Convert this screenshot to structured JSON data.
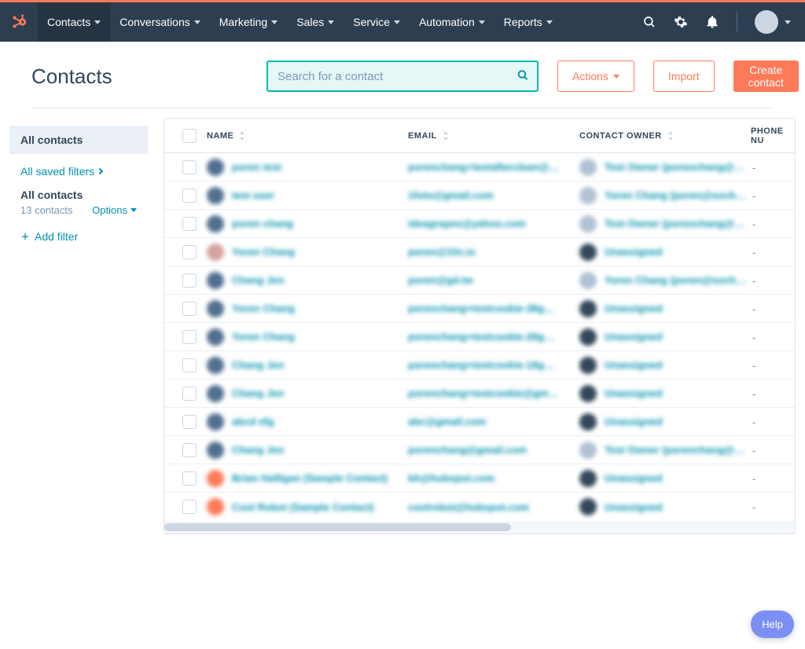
{
  "topnav": {
    "items": [
      {
        "label": "Contacts",
        "active": true
      },
      {
        "label": "Conversations"
      },
      {
        "label": "Marketing"
      },
      {
        "label": "Sales"
      },
      {
        "label": "Service"
      },
      {
        "label": "Automation"
      },
      {
        "label": "Reports"
      }
    ]
  },
  "header": {
    "title": "Contacts",
    "search_placeholder": "Search for a contact",
    "actions_label": "Actions",
    "import_label": "Import",
    "create_label": "Create contact"
  },
  "sidebar": {
    "all_label": "All contacts",
    "saved_filters_label": "All saved filters",
    "current_view": "All contacts",
    "count_text": "13 contacts",
    "options_label": "Options",
    "add_filter_label": "Add filter"
  },
  "table": {
    "columns": {
      "name": "NAME",
      "email": "EMAIL",
      "owner": "CONTACT OWNER",
      "phone": "PHONE NU"
    },
    "rows": [
      {
        "avatar": "default",
        "name": "poren test",
        "email": "porenchang+testafterclean@…",
        "owner": "Test Owner (porenchang@…",
        "owner_avatar": "light",
        "phone": "-"
      },
      {
        "avatar": "default",
        "name": "test user",
        "email": "1foto@gmail.com",
        "owner": "Yoren Chang (poren@soch…",
        "owner_avatar": "light",
        "phone": "-"
      },
      {
        "avatar": "default",
        "name": "poren chang",
        "email": "ideagrapes@yahoo.com",
        "owner": "Test Owner (porenchang@…",
        "owner_avatar": "light",
        "phone": "-"
      },
      {
        "avatar": "img",
        "name": "Yoren Chang",
        "email": "poren@10x.io",
        "owner": "Unassigned",
        "owner_avatar": "dark",
        "phone": "-"
      },
      {
        "avatar": "default",
        "name": "Chang Jen",
        "email": "poren@gd.tw",
        "owner": "Yoren Chang (poren@soch…",
        "owner_avatar": "light",
        "phone": "-"
      },
      {
        "avatar": "default",
        "name": "Yoren Chang",
        "email": "porenchang+testcookie-38g…",
        "owner": "Unassigned",
        "owner_avatar": "dark",
        "phone": "-"
      },
      {
        "avatar": "default",
        "name": "Yoren Chang",
        "email": "porenchang+testcookie-28g…",
        "owner": "Unassigned",
        "owner_avatar": "dark",
        "phone": "-"
      },
      {
        "avatar": "default",
        "name": "Chang Jen",
        "email": "porenchang+testcookie-18g…",
        "owner": "Unassigned",
        "owner_avatar": "dark",
        "phone": "-"
      },
      {
        "avatar": "default",
        "name": "Chang Jen",
        "email": "porenchang+testcookie@gm…",
        "owner": "Unassigned",
        "owner_avatar": "dark",
        "phone": "-"
      },
      {
        "avatar": "default",
        "name": "abcd efg",
        "email": "abc@gmail.com",
        "owner": "Unassigned",
        "owner_avatar": "dark",
        "phone": "-"
      },
      {
        "avatar": "default",
        "name": "Chang Jen",
        "email": "porenchang@gmail.com",
        "owner": "Test Owner (porenchang@…",
        "owner_avatar": "light",
        "phone": "-"
      },
      {
        "avatar": "orange",
        "name": "Brian Halligan (Sample Contact)",
        "email": "bh@hubspot.com",
        "owner": "Unassigned",
        "owner_avatar": "dark",
        "phone": "-"
      },
      {
        "avatar": "orange",
        "name": "Cool Robot (Sample Contact)",
        "email": "coolrobot@hubspot.com",
        "owner": "Unassigned",
        "owner_avatar": "dark",
        "phone": "-"
      }
    ]
  },
  "help_label": "Help"
}
